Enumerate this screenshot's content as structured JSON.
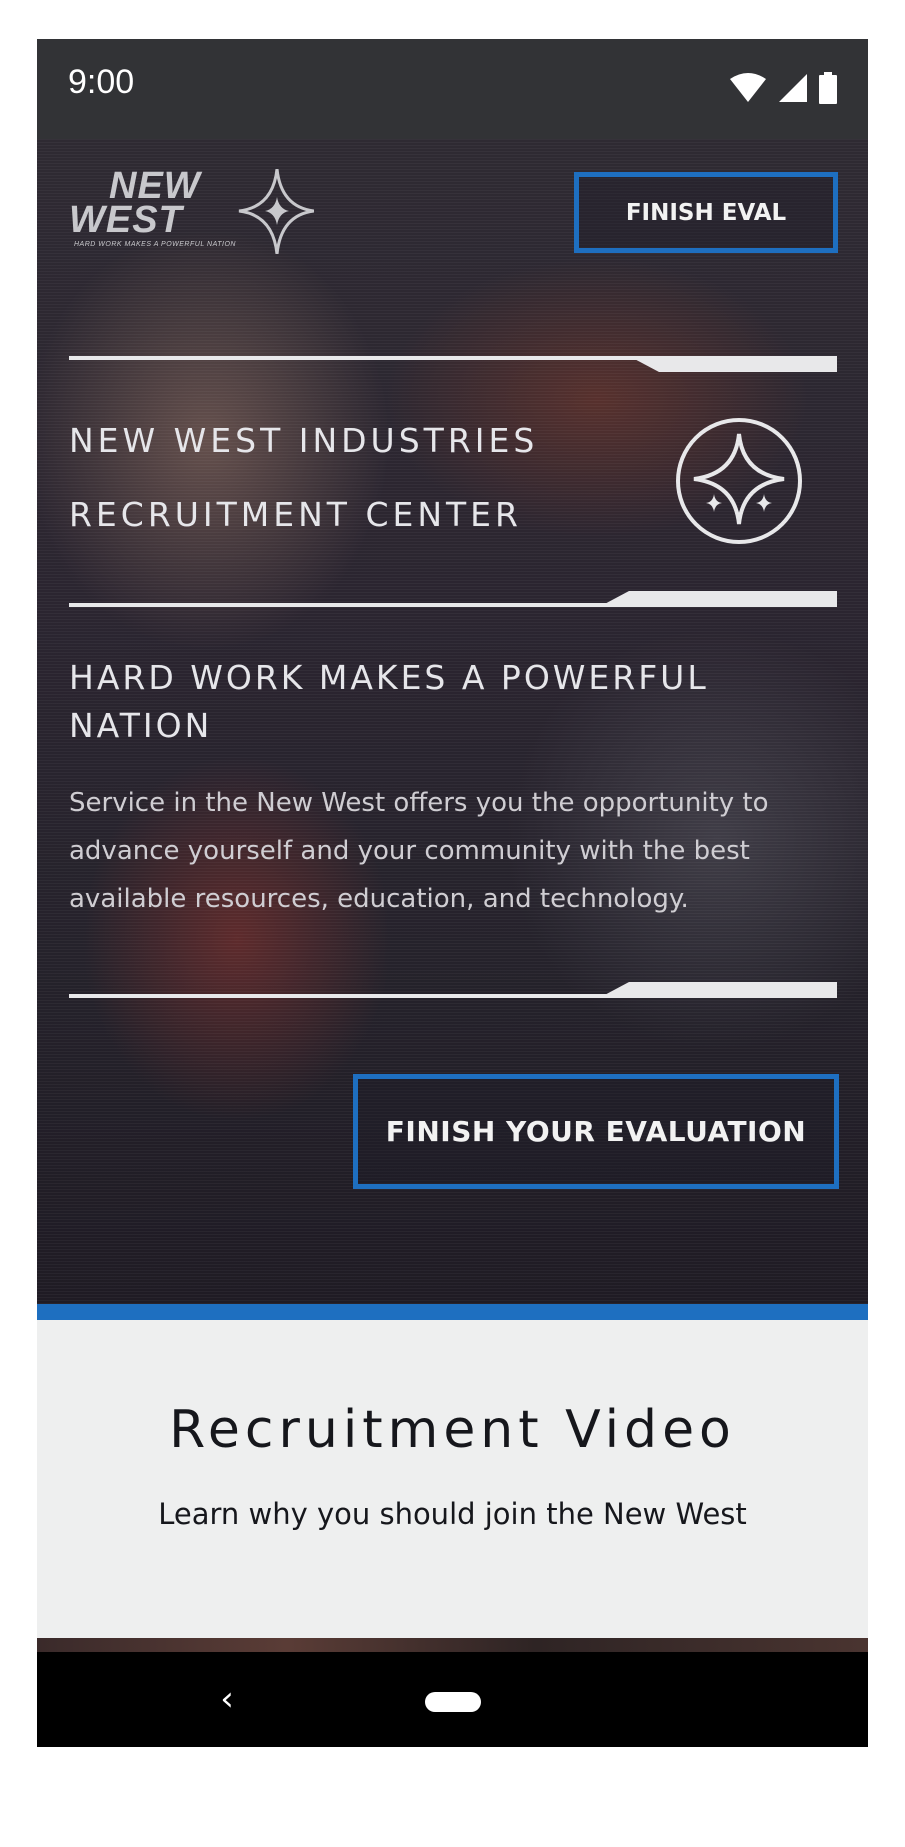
{
  "status_bar": {
    "time": "9:00",
    "icons": [
      "wifi-icon",
      "cell-signal-icon",
      "battery-icon"
    ]
  },
  "header": {
    "logo": {
      "line1": "NEW",
      "line2": "WEST",
      "tagline": "HARD WORK MAKES A POWERFUL NATION"
    },
    "finish_eval_label": "FINISH EVAL"
  },
  "hero": {
    "title_line1": "NEW WEST INDUSTRIES",
    "title_line2": "RECRUITMENT CENTER",
    "emblem_icon": "star-emblem-icon",
    "motto": "HARD WORK MAKES A POWERFUL NATION",
    "description": "Service in the New West offers you the opportunity to advance yourself and your community with the best available resources, education, and technology.",
    "cta_label": "FINISH YOUR EVALUATION"
  },
  "video_section": {
    "title": "Recruitment Video",
    "subtitle": "Learn why you should join the New West"
  },
  "nav_bar": {
    "back_icon": "back-chevron-icon",
    "home_icon": "home-pill-icon"
  },
  "colors": {
    "accent": "#1e6fc0",
    "status_bar": "#323336",
    "section_bg": "#eeefef",
    "text_light": "#e6e6ea"
  }
}
